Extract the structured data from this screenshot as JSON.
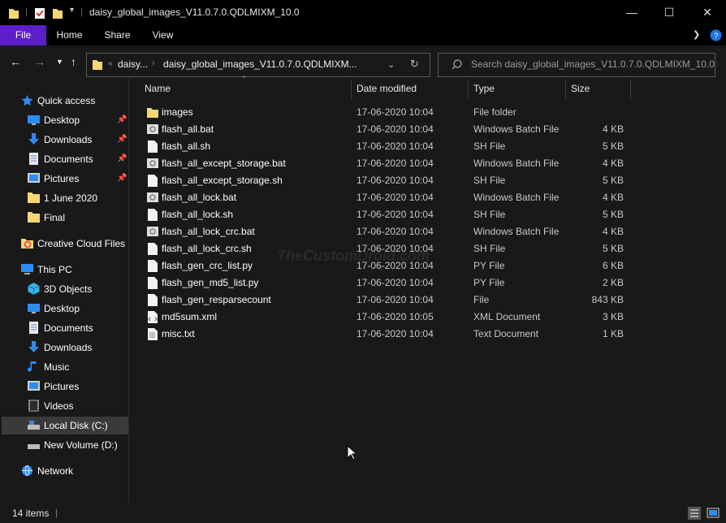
{
  "window": {
    "title": "daisy_global_images_V11.0.7.0.QDLMIXM_10.0"
  },
  "ribbon": {
    "tabs": [
      "File",
      "Home",
      "Share",
      "View"
    ]
  },
  "address": {
    "prefix": "«",
    "crumb1": "daisy...",
    "crumb2": "daisy_global_images_V11.0.7.0.QDLMIXM..."
  },
  "search": {
    "placeholder": "Search daisy_global_images_V11.0.7.0.QDLMIXM_10.0"
  },
  "sidebar": {
    "items": [
      {
        "label": "Quick access",
        "icon": "star-icon"
      },
      {
        "label": "Desktop",
        "icon": "desktop-icon",
        "pinned": true
      },
      {
        "label": "Downloads",
        "icon": "download-icon",
        "pinned": true
      },
      {
        "label": "Documents",
        "icon": "documents-icon",
        "pinned": true
      },
      {
        "label": "Pictures",
        "icon": "pictures-icon",
        "pinned": true
      },
      {
        "label": "1 June 2020",
        "icon": "folder-icon"
      },
      {
        "label": "Final",
        "icon": "folder-icon"
      },
      {
        "label": "Creative Cloud Files",
        "icon": "creative-cloud-icon"
      },
      {
        "label": "This PC",
        "icon": "computer-icon"
      },
      {
        "label": "3D Objects",
        "icon": "cube-icon"
      },
      {
        "label": "Desktop",
        "icon": "desktop-icon"
      },
      {
        "label": "Documents",
        "icon": "documents-icon"
      },
      {
        "label": "Downloads",
        "icon": "download-icon"
      },
      {
        "label": "Music",
        "icon": "music-icon"
      },
      {
        "label": "Pictures",
        "icon": "pictures-icon"
      },
      {
        "label": "Videos",
        "icon": "video-icon"
      },
      {
        "label": "Local Disk (C:)",
        "icon": "drive-icon",
        "selected": true
      },
      {
        "label": "New Volume (D:)",
        "icon": "drive-icon"
      },
      {
        "label": "Network",
        "icon": "network-icon"
      }
    ]
  },
  "columns": {
    "name": "Name",
    "date": "Date modified",
    "type": "Type",
    "size": "Size"
  },
  "files": [
    {
      "name": "images",
      "date": "17-06-2020 10:04",
      "type": "File folder",
      "size": "",
      "icon": "folder-icon"
    },
    {
      "name": "flash_all.bat",
      "date": "17-06-2020 10:04",
      "type": "Windows Batch File",
      "size": "4 KB",
      "icon": "batch-file-icon"
    },
    {
      "name": "flash_all.sh",
      "date": "17-06-2020 10:04",
      "type": "SH File",
      "size": "5 KB",
      "icon": "file-icon"
    },
    {
      "name": "flash_all_except_storage.bat",
      "date": "17-06-2020 10:04",
      "type": "Windows Batch File",
      "size": "4 KB",
      "icon": "batch-file-icon"
    },
    {
      "name": "flash_all_except_storage.sh",
      "date": "17-06-2020 10:04",
      "type": "SH File",
      "size": "5 KB",
      "icon": "file-icon"
    },
    {
      "name": "flash_all_lock.bat",
      "date": "17-06-2020 10:04",
      "type": "Windows Batch File",
      "size": "4 KB",
      "icon": "batch-file-icon"
    },
    {
      "name": "flash_all_lock.sh",
      "date": "17-06-2020 10:04",
      "type": "SH File",
      "size": "5 KB",
      "icon": "file-icon"
    },
    {
      "name": "flash_all_lock_crc.bat",
      "date": "17-06-2020 10:04",
      "type": "Windows Batch File",
      "size": "4 KB",
      "icon": "batch-file-icon"
    },
    {
      "name": "flash_all_lock_crc.sh",
      "date": "17-06-2020 10:04",
      "type": "SH File",
      "size": "5 KB",
      "icon": "file-icon"
    },
    {
      "name": "flash_gen_crc_list.py",
      "date": "17-06-2020 10:04",
      "type": "PY File",
      "size": "6 KB",
      "icon": "file-icon"
    },
    {
      "name": "flash_gen_md5_list.py",
      "date": "17-06-2020 10:04",
      "type": "PY File",
      "size": "2 KB",
      "icon": "file-icon"
    },
    {
      "name": "flash_gen_resparsecount",
      "date": "17-06-2020 10:04",
      "type": "File",
      "size": "843 KB",
      "icon": "file-icon"
    },
    {
      "name": "md5sum.xml",
      "date": "17-06-2020 10:05",
      "type": "XML Document",
      "size": "3 KB",
      "icon": "xml-file-icon"
    },
    {
      "name": "misc.txt",
      "date": "17-06-2020 10:04",
      "type": "Text Document",
      "size": "1 KB",
      "icon": "text-file-icon"
    }
  ],
  "status": {
    "count": "14 items"
  },
  "watermark": "TheCustomDroid.com"
}
